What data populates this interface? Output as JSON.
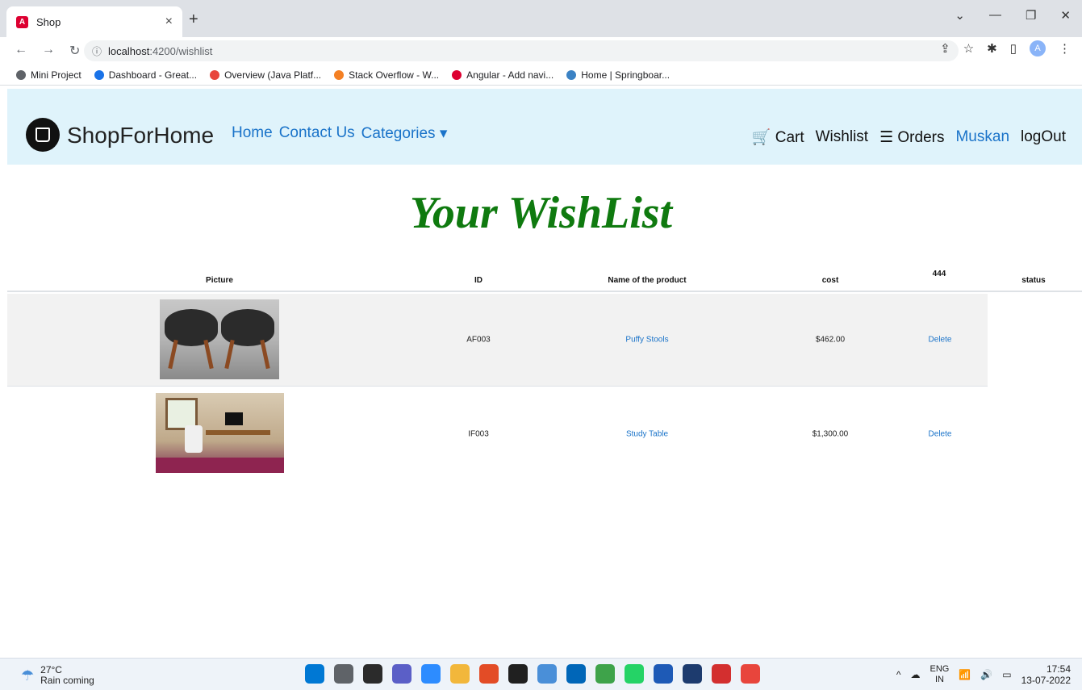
{
  "browser": {
    "tab_title": "Shop",
    "tab_close": "×",
    "new_tab": "+",
    "url_host": "localhost",
    "url_rest": ":4200/wishlist",
    "bookmarks": [
      {
        "label": "Mini Project",
        "color": "#5f6368"
      },
      {
        "label": "Dashboard - Great...",
        "color": "#1a73e8"
      },
      {
        "label": "Overview (Java Platf...",
        "color": "#e8453c"
      },
      {
        "label": "Stack Overflow - W...",
        "color": "#f48024"
      },
      {
        "label": "Angular - Add navi...",
        "color": "#dd0031"
      },
      {
        "label": "Home | Springboar...",
        "color": "#3b82c4"
      }
    ],
    "profile_initial": "A"
  },
  "nav": {
    "brand": "ShopForHome",
    "links": [
      "Home",
      "Contact Us",
      "Categories ▾"
    ],
    "cart": "Cart",
    "wishlist": "Wishlist",
    "orders": "Orders",
    "user": "Muskan",
    "logout": "logOut"
  },
  "page": {
    "title": "Your WishList"
  },
  "table": {
    "headers": {
      "picture": "Picture",
      "id": "ID",
      "name": "Name of the product",
      "cost": "cost",
      "extra": "444",
      "status": "status"
    },
    "rows": [
      {
        "id": "AF003",
        "name": "Puffy Stools",
        "cost": "$462.00",
        "action": "Delete"
      },
      {
        "id": "IF003",
        "name": "Study Table",
        "cost": "$1,300.00",
        "action": "Delete"
      }
    ]
  },
  "taskbar": {
    "temperature": "27°C",
    "weather": "Rain coming",
    "lang_top": "ENG",
    "lang_bottom": "IN",
    "time": "17:54",
    "date": "13-07-2022",
    "app_colors": [
      "#0078d4",
      "#5f6368",
      "#2b2b2b",
      "#5b5fc7",
      "#2d8cff",
      "#f2b73b",
      "#e34c26",
      "#202020",
      "#4a8fd8",
      "#0066b8",
      "#3ea34a",
      "#25d366",
      "#1e5ab6",
      "#1d3b6e",
      "#d32f2f",
      "#e8453c"
    ]
  },
  "colors": {
    "nav_bg": "#dff3fb",
    "link": "#1a73c9",
    "heading": "#0f7a0f"
  }
}
